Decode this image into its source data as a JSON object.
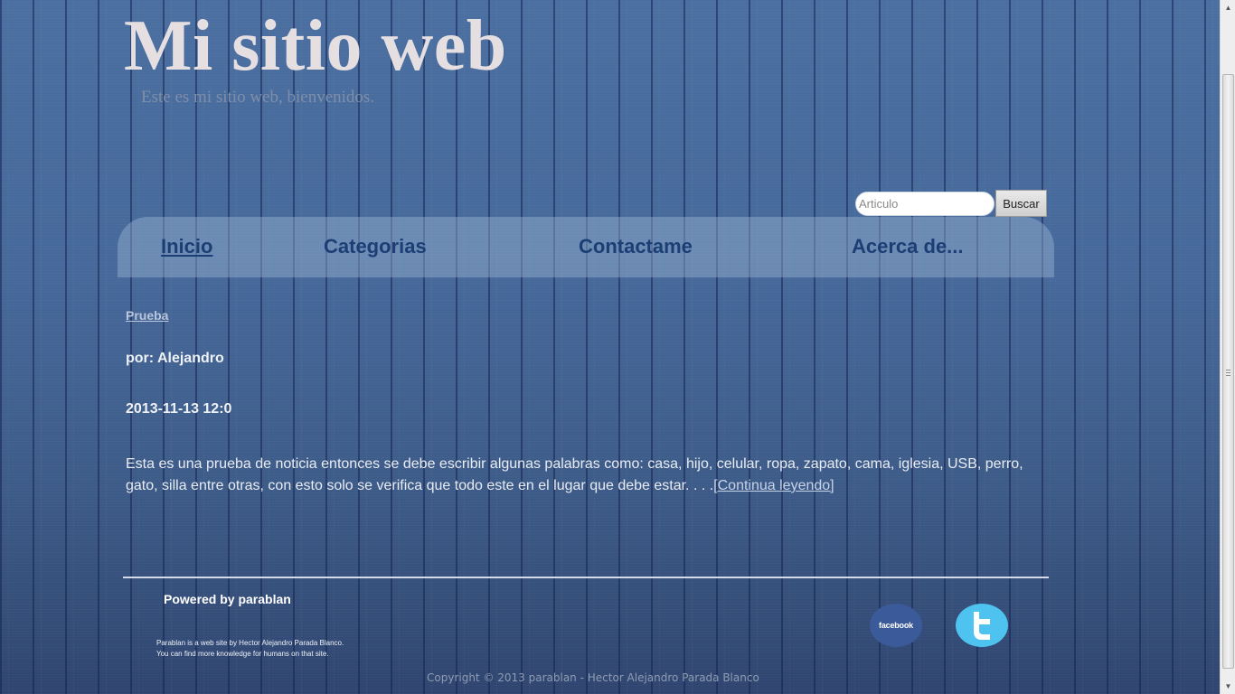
{
  "header": {
    "title": "Mi sitio web",
    "subtitle": "Este es mi sitio web, bienvenidos."
  },
  "search": {
    "placeholder": "Articulo",
    "button_label": "Buscar"
  },
  "nav": {
    "items": [
      {
        "label": "Inicio",
        "active": true
      },
      {
        "label": "Categorias",
        "active": false
      },
      {
        "label": "Contactame",
        "active": false
      },
      {
        "label": "Acerca de...",
        "active": false
      }
    ]
  },
  "post": {
    "title": "Prueba",
    "author": "por: Alejandro",
    "date": "2013-11-13 12:0",
    "body": "Esta es una prueba de noticia entonces se debe escribir algunas palabras como: casa, hijo, celular, ropa, zapato, cama, iglesia, USB, perro, gato, silla entre otras, con esto solo se verifica que todo este en el lugar que debe estar. . . .",
    "read_more": "[Continua leyendo]"
  },
  "footer": {
    "heading": "Powered by parablan",
    "desc_line1": "Parablan is a web site by Hector Alejandro Parada Blanco.",
    "desc_line2": "You can find more knowledge for humans on that site.",
    "facebook_label": "facebook",
    "copyright": "Copyright © 2013 parablan - Hector Alejandro Parada Blanco"
  },
  "colors": {
    "background": "#3d5f8f",
    "nav_text": "#1b3e74",
    "facebook": "#3b5a9a",
    "twitter": "#4fc3ef"
  },
  "icons": {
    "facebook": "facebook-icon",
    "twitter": "twitter-icon"
  }
}
